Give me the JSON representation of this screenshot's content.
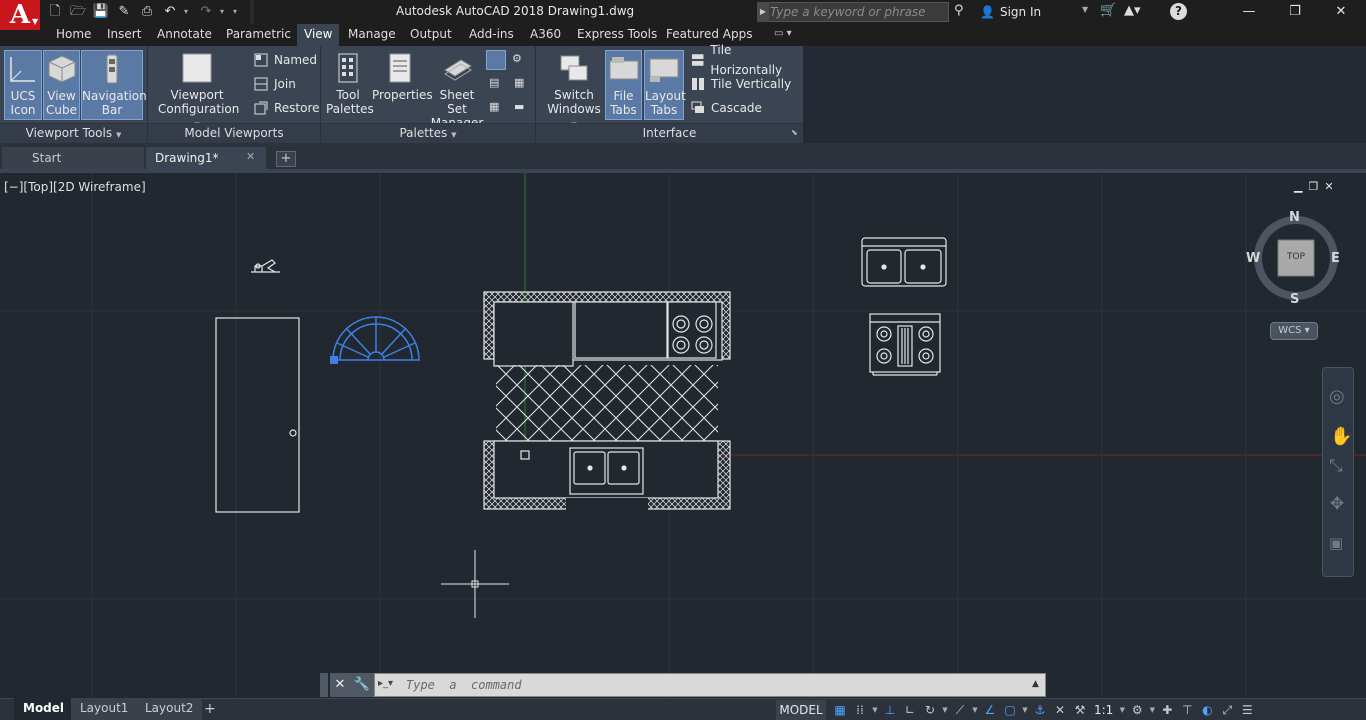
{
  "window": {
    "title": "Autodesk AutoCAD 2018   Drawing1.dwg",
    "app_logo": "A",
    "minimize": "—",
    "restore": "❐",
    "close": "✕"
  },
  "search": {
    "placeholder": "Type a keyword or phrase"
  },
  "account": {
    "sign_in": "Sign In"
  },
  "ribbon_tabs": [
    "Home",
    "Insert",
    "Annotate",
    "Parametric",
    "View",
    "Manage",
    "Output",
    "Add-ins",
    "A360",
    "Express Tools",
    "Featured Apps"
  ],
  "ribbon": {
    "ucs_icon": [
      "UCS",
      "Icon"
    ],
    "view_cube": [
      "View",
      "Cube"
    ],
    "navigation_bar": [
      "Navigation",
      "Bar"
    ],
    "viewport_configuration": [
      "Viewport",
      "Configuration"
    ],
    "named": "Named",
    "join": "Join",
    "restore": "Restore",
    "tool_palettes": [
      "Tool",
      "Palettes"
    ],
    "properties": "Properties",
    "sheet_set_manager": [
      "Sheet Set",
      "Manager"
    ],
    "switch_windows": [
      "Switch",
      "Windows"
    ],
    "file_tabs": [
      "File",
      "Tabs"
    ],
    "layout_tabs": [
      "Layout",
      "Tabs"
    ],
    "tile_horizontally": "Tile Horizontally",
    "tile_vertically": "Tile Vertically",
    "cascade": "Cascade",
    "panels": {
      "viewport_tools": "Viewport Tools",
      "model_viewports": "Model Viewports",
      "palettes": "Palettes",
      "interface": "Interface"
    }
  },
  "file_tabs": {
    "start": "Start",
    "drawing": "Drawing1*",
    "close": "✕",
    "add": "+"
  },
  "viewport": {
    "label": "[−][Top][2D Wireframe]",
    "ctrl_min": "▁",
    "ctrl_restore": "❐",
    "ctrl_close": "✕"
  },
  "viewcube": {
    "n": "N",
    "s": "S",
    "e": "E",
    "w": "W",
    "face": "TOP",
    "wcs": "WCS"
  },
  "command": {
    "placeholder": "Type  a  command",
    "close": "✕",
    "wrench": "🔧",
    "prompt": "▸_▾"
  },
  "layout_tabs": [
    "Model",
    "Layout1",
    "Layout2"
  ],
  "status": {
    "model": "MODEL",
    "scale": "1:1"
  },
  "colors": {
    "accent": "#5a7aa5",
    "background": "#212830",
    "grid_major": "#2d3641",
    "x_axis": "#8b2020",
    "y_axis": "#2b7a2b",
    "selected": "#3f7fe8"
  }
}
